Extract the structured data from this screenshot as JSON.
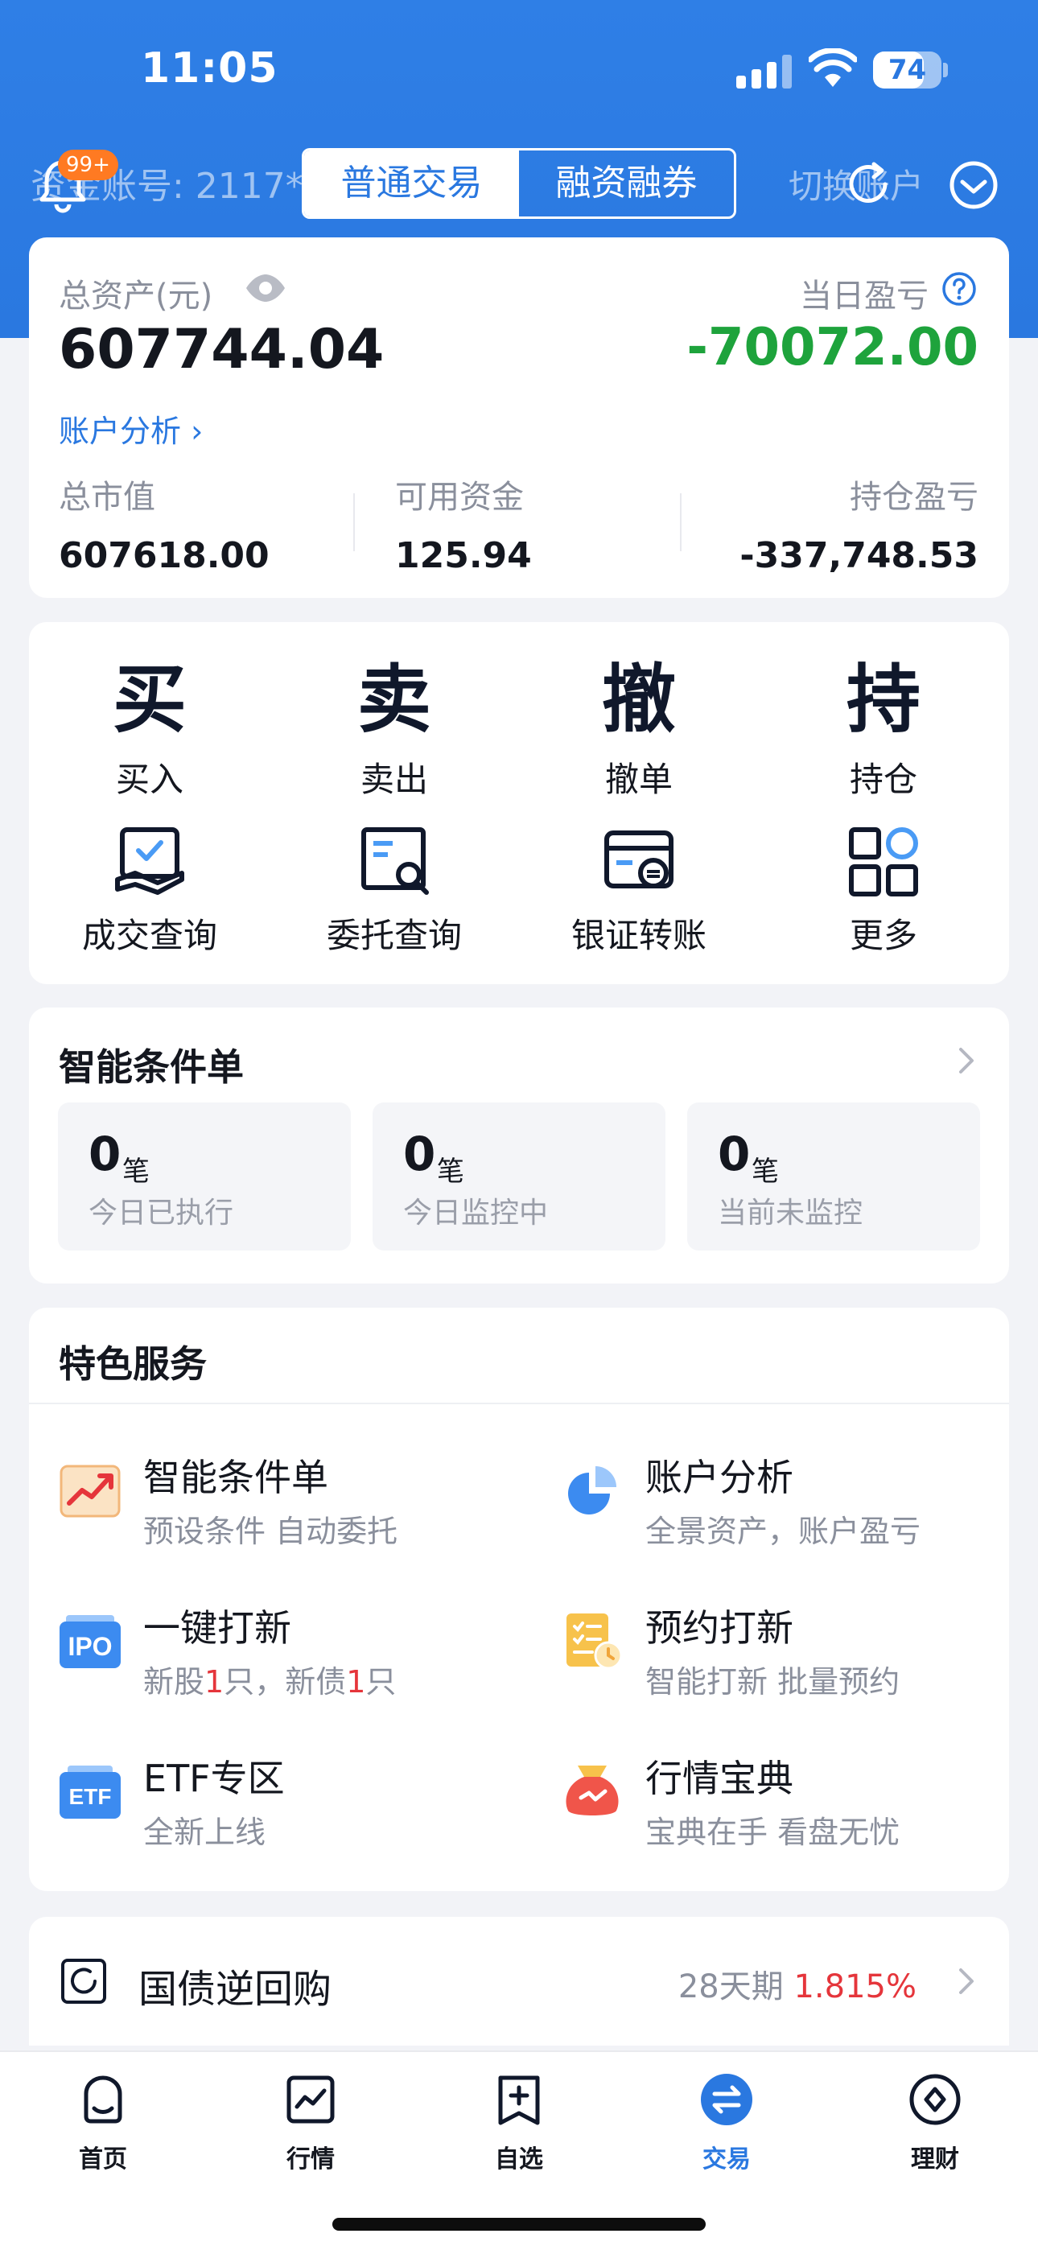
{
  "status_bar": {
    "time": "11:05",
    "battery": "74",
    "battery_level": 0.74
  },
  "header": {
    "account_label": "资金账号: 2117*",
    "notification_badge": "99+",
    "tabs": [
      {
        "label": "普通交易",
        "active": true
      },
      {
        "label": "融资融券",
        "active": false
      }
    ],
    "switch_account_label": "切换账户"
  },
  "assets": {
    "total_label": "总资产(元)",
    "total_value": "607744.04",
    "daily_pnl_label": "当日盈亏",
    "daily_pnl_value": "-70072.00",
    "analysis_link": "账户分析",
    "stats": [
      {
        "label": "总市值",
        "value": "607618.00"
      },
      {
        "label": "可用资金",
        "value": "125.94"
      },
      {
        "label": "持仓盈亏",
        "value": "-337,748.53"
      }
    ]
  },
  "operations": [
    {
      "glyph": "买",
      "label": "买入"
    },
    {
      "glyph": "卖",
      "label": "卖出"
    },
    {
      "glyph": "撤",
      "label": "撤单"
    },
    {
      "glyph": "持",
      "label": "持仓"
    },
    {
      "icon": "deal-query-icon",
      "label": "成交查询"
    },
    {
      "icon": "order-query-icon",
      "label": "委托查询"
    },
    {
      "icon": "bank-transfer-icon",
      "label": "银证转账"
    },
    {
      "icon": "more-grid-icon",
      "label": "更多"
    }
  ],
  "conditional_orders": {
    "title": "智能条件单",
    "boxes": [
      {
        "count": "0",
        "unit": "笔",
        "label": "今日已执行"
      },
      {
        "count": "0",
        "unit": "笔",
        "label": "今日监控中"
      },
      {
        "count": "0",
        "unit": "笔",
        "label": "当前未监控"
      }
    ]
  },
  "features": {
    "title": "特色服务",
    "items": [
      {
        "name": "智能条件单",
        "desc": "预设条件 自动委托",
        "icon": "trend-chart-icon"
      },
      {
        "name": "账户分析",
        "desc": "全景资产，账户盈亏",
        "icon": "pie-chart-icon"
      },
      {
        "name": "一键打新",
        "desc_parts": [
          "新股",
          "1",
          "只，新债",
          "1",
          "只"
        ],
        "icon": "ipo-icon"
      },
      {
        "name": "预约打新",
        "desc": "智能打新 批量预约",
        "icon": "reserve-icon"
      },
      {
        "name": "ETF专区",
        "desc": "全新上线",
        "icon": "etf-icon"
      },
      {
        "name": "行情宝典",
        "desc": "宝典在手 看盘无忧",
        "icon": "treasure-bag-icon"
      }
    ]
  },
  "repo": {
    "name": "国债逆回购",
    "term": "28天期",
    "rate": "1.815%"
  },
  "tabbar": [
    {
      "label": "首页",
      "icon": "home-icon",
      "active": false
    },
    {
      "label": "行情",
      "icon": "market-icon",
      "active": false
    },
    {
      "label": "自选",
      "icon": "watchlist-icon",
      "active": false
    },
    {
      "label": "交易",
      "icon": "trade-icon",
      "active": true
    },
    {
      "label": "理财",
      "icon": "finance-icon",
      "active": false
    }
  ],
  "colors": {
    "brand": "#2a78e0",
    "loss_green": "#1ea33c",
    "gain_red": "#e5353b",
    "badge_orange": "#ff7a22"
  }
}
